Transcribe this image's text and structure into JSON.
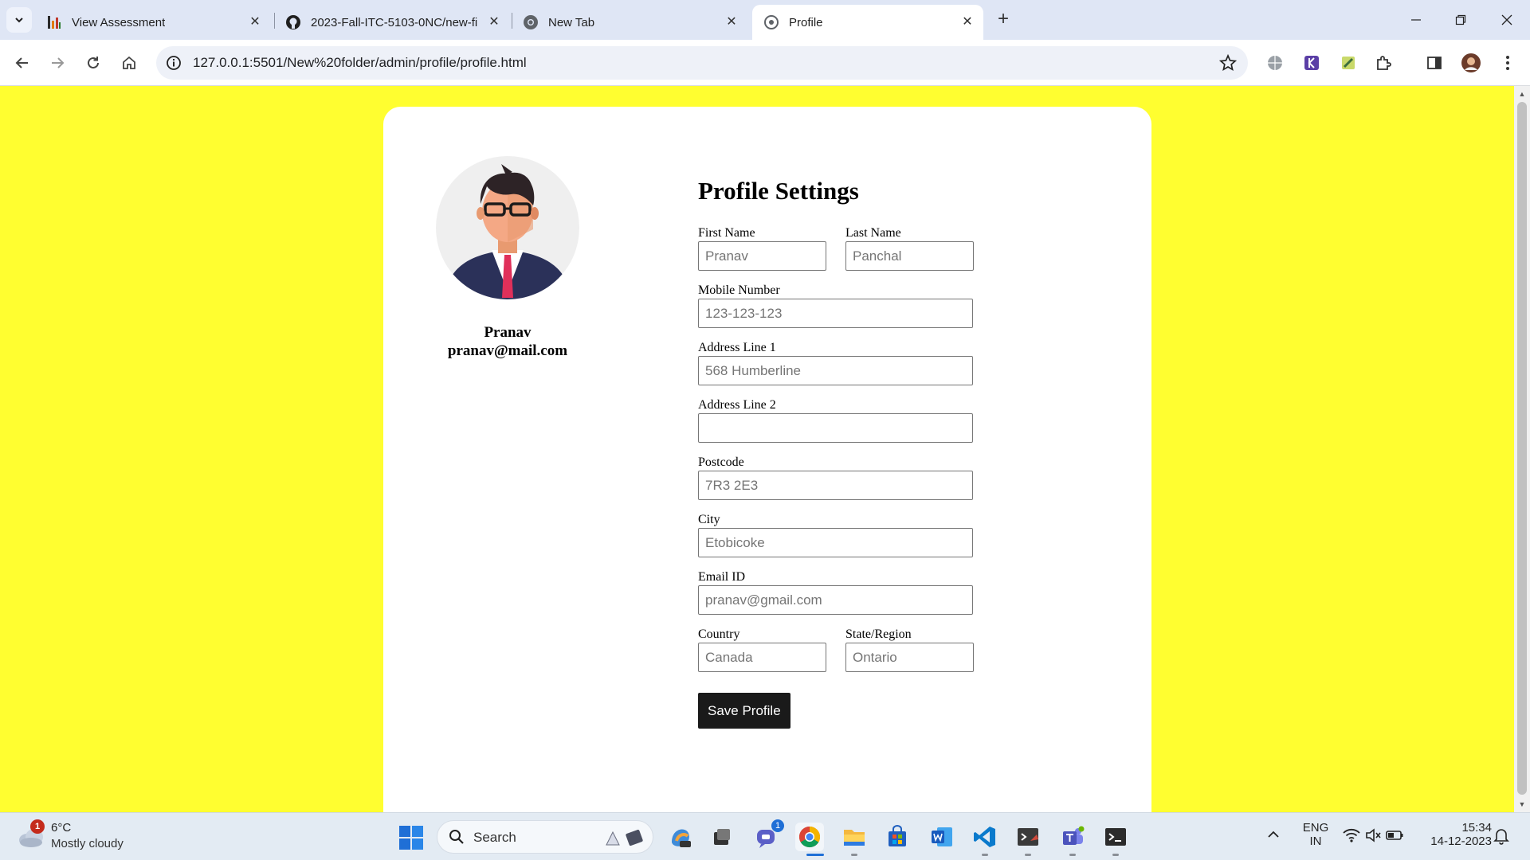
{
  "browser": {
    "tabs": [
      {
        "title": "View Assessment",
        "active": false,
        "icon": "bar-chart-icon"
      },
      {
        "title": "2023-Fall-ITC-5103-0NC/new-fi",
        "active": false,
        "icon": "github-icon"
      },
      {
        "title": "New Tab",
        "active": false,
        "icon": "chrome-icon"
      },
      {
        "title": "Profile",
        "active": true,
        "icon": "globe-icon"
      }
    ],
    "url": "127.0.0.1:5501/New%20folder/admin/profile/profile.html"
  },
  "profile": {
    "name": "Pranav",
    "email": "pranav@mail.com"
  },
  "form": {
    "heading": "Profile Settings",
    "first_name": {
      "label": "First Name",
      "placeholder": "Pranav"
    },
    "last_name": {
      "label": "Last Name",
      "placeholder": "Panchal"
    },
    "mobile": {
      "label": "Mobile Number",
      "placeholder": "123-123-123"
    },
    "address1": {
      "label": "Address Line 1",
      "placeholder": "568 Humberline"
    },
    "address2": {
      "label": "Address Line 2",
      "placeholder": ""
    },
    "postcode": {
      "label": "Postcode",
      "placeholder": "7R3 2E3"
    },
    "city": {
      "label": "City",
      "placeholder": "Etobicoke"
    },
    "email_id": {
      "label": "Email ID",
      "placeholder": "pranav@gmail.com"
    },
    "country": {
      "label": "Country",
      "placeholder": "Canada"
    },
    "state": {
      "label": "State/Region",
      "placeholder": "Ontario"
    },
    "save_label": "Save Profile"
  },
  "taskbar": {
    "weather_temp": "6°C",
    "weather_cond": "Mostly cloudy",
    "weather_badge": "1",
    "search_label": "Search",
    "chat_badge": "1",
    "lang_top": "ENG",
    "lang_bottom": "IN",
    "time": "15:34",
    "date": "14-12-2023"
  },
  "colors": {
    "page_bg": "#fffe30",
    "button_bg": "#1a1a1a"
  }
}
